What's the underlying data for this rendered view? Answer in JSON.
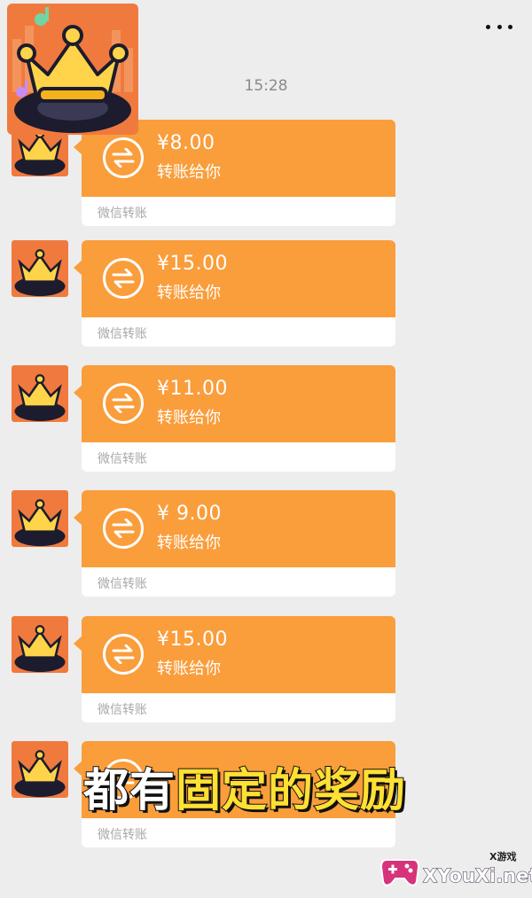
{
  "header": {
    "time": "15:28",
    "more_icon": "more-dots-icon"
  },
  "colors": {
    "bubble": "#fa9d3b",
    "background": "#ededed",
    "caption_yellow": "#ffe033"
  },
  "messages": [
    {
      "amount": "¥8.00",
      "desc": "转账给你",
      "footer": "微信转账"
    },
    {
      "amount": "¥15.00",
      "desc": "转账给你",
      "footer": "微信转账"
    },
    {
      "amount": "¥11.00",
      "desc": "转账给你",
      "footer": "微信转账"
    },
    {
      "amount": "¥ 9.00",
      "desc": "转账给你",
      "footer": "微信转账"
    },
    {
      "amount": "¥15.00",
      "desc": "转账给你",
      "footer": "微信转账"
    },
    {
      "amount": "",
      "desc": "",
      "footer": "微信转账"
    }
  ],
  "overlay_caption": {
    "part1": "都有",
    "part2": "固定的奖励"
  },
  "watermark": {
    "brand": "XYouXi.net",
    "small": "X游戏"
  }
}
